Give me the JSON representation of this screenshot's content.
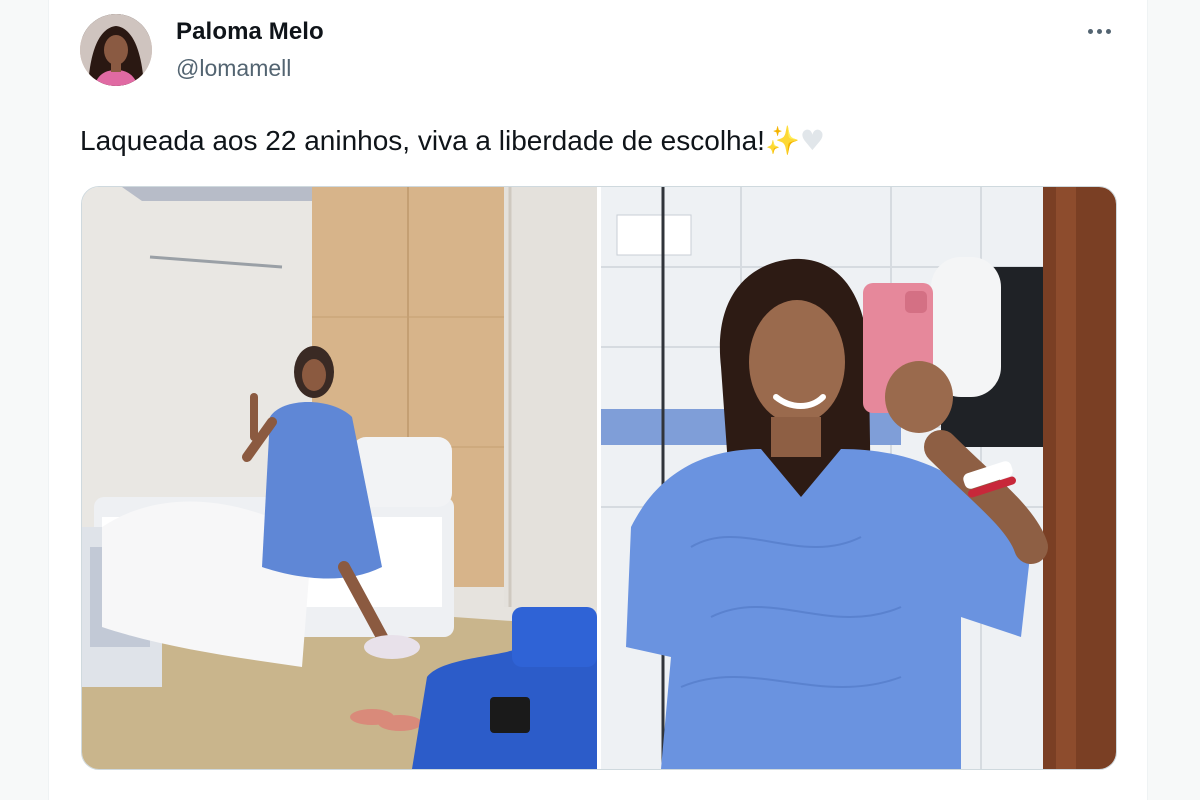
{
  "author": {
    "display_name": "Paloma Melo",
    "handle": "@lomamell"
  },
  "tweet": {
    "text": "Laqueada aos 22 aninhos, viva a liberdade de escolha!",
    "emoji_sparkles": "✨",
    "emoji_heart": "♥"
  },
  "colors": {
    "text_primary": "#0f1419",
    "text_secondary": "#536471",
    "border": "#cfd9de"
  },
  "icons": {
    "more": "more-options-icon"
  }
}
